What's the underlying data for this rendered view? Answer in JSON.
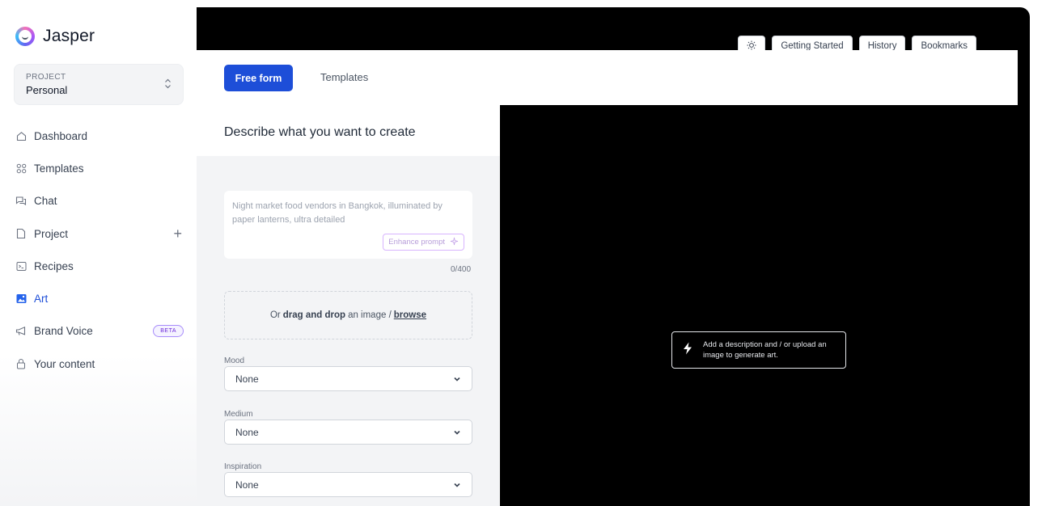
{
  "app": {
    "name": "Jasper"
  },
  "project": {
    "label": "PROJECT",
    "value": "Personal"
  },
  "sidebar": {
    "items": [
      {
        "label": "Dashboard",
        "icon": "home-icon"
      },
      {
        "label": "Templates",
        "icon": "grid-icon"
      },
      {
        "label": "Chat",
        "icon": "chat-icon"
      },
      {
        "label": "Project",
        "icon": "file-icon",
        "action": "+"
      },
      {
        "label": "Recipes",
        "icon": "terminal-icon"
      },
      {
        "label": "Art",
        "icon": "image-icon",
        "active": true
      },
      {
        "label": "Brand Voice",
        "icon": "megaphone-icon",
        "badge": "BETA"
      },
      {
        "label": "Your content",
        "icon": "lock-icon"
      }
    ]
  },
  "topbar": {
    "buttons": [
      "Getting Started",
      "History",
      "Bookmarks"
    ]
  },
  "tabs": {
    "free_form": "Free form",
    "templates": "Templates"
  },
  "form": {
    "heading": "Describe what you want to create",
    "prompt_placeholder": "Night market food vendors in Bangkok, illuminated by paper lanterns, ultra detailed",
    "enhance_label": "Enhance prompt",
    "counter": "0/400",
    "drop": {
      "prefix": "Or",
      "bold": "drag and drop",
      "middle": "an image /",
      "link": "browse"
    },
    "fields": [
      {
        "label": "Mood",
        "value": "None"
      },
      {
        "label": "Medium",
        "value": "None"
      },
      {
        "label": "Inspiration",
        "value": "None"
      }
    ]
  },
  "canvas": {
    "hint": "Add a description and / or upload an image to generate art."
  },
  "colors": {
    "primary": "#1d4ed8",
    "canvas": "#000000",
    "sidebar": "#ffffff"
  }
}
